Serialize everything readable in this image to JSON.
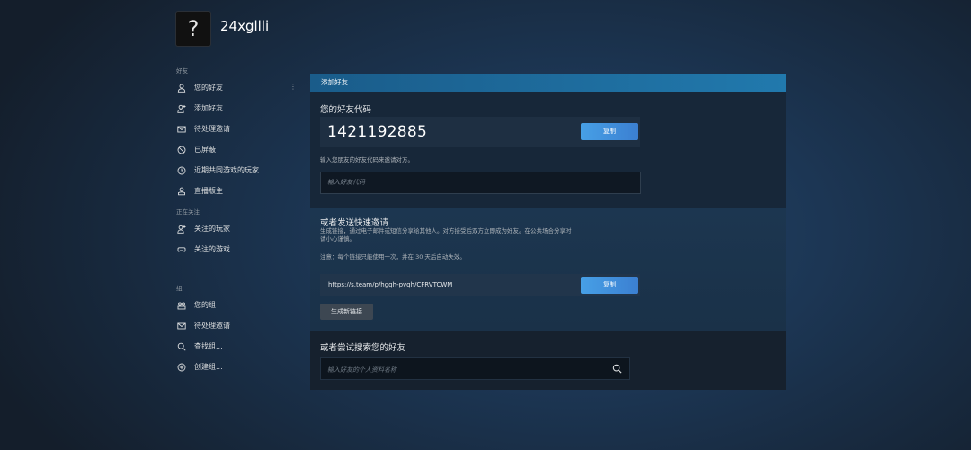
{
  "profile": {
    "username": "24xgllli",
    "avatar_glyph": "?"
  },
  "sidebar": {
    "section_friends": "好友",
    "friends_items": [
      {
        "label": "您的好友",
        "icon": "person-icon"
      },
      {
        "label": "添加好友",
        "icon": "person-add-icon"
      },
      {
        "label": "待处理邀请",
        "icon": "mail-icon"
      },
      {
        "label": "已屏蔽",
        "icon": "block-icon"
      },
      {
        "label": "近期共同游戏的玩家",
        "icon": "clock-icon"
      },
      {
        "label": "直播版主",
        "icon": "broadcast-mod-icon"
      }
    ],
    "friends_menu_dots": "⋮",
    "section_following": "正在关注",
    "following_items": [
      {
        "label": "关注的玩家",
        "icon": "person-follow-icon"
      },
      {
        "label": "关注的游戏...",
        "icon": "gamepad-icon"
      }
    ],
    "section_groups": "组",
    "group_items": [
      {
        "label": "您的组",
        "icon": "group-icon"
      },
      {
        "label": "待处理邀请",
        "icon": "mail-icon"
      },
      {
        "label": "查找组...",
        "icon": "search-icon"
      },
      {
        "label": "创建组...",
        "icon": "plus-circle-icon"
      }
    ]
  },
  "panel": {
    "header": "添加好友",
    "friend_code_title": "您的好友代码",
    "friend_code": "1421192885",
    "copy_label": "复制",
    "enter_code_hint": "输入您朋友的好友代码来邀请对方。",
    "enter_code_placeholder": "输入好友代码",
    "quick_invite_title": "或者发送快速邀请",
    "quick_invite_desc_1": "生成链接，通过电子邮件或短信分享给其他人。对方接受后双方立即成为好友。在公共场合分享时",
    "quick_invite_desc_2": "请小心谨慎。",
    "quick_invite_note": "注意：每个链接只能使用一次，并在 30 天后自动失效。",
    "invite_link": "https://s.team/p/hgqh-pvqh/CFRVTCWM",
    "copy_link_label": "复制",
    "generate_link_label": "生成新链接",
    "search_title": "或者尝试搜索您的好友",
    "search_placeholder": "输入好友的个人资料名称"
  },
  "colors": {
    "accent": "#1f6fa0",
    "button_blue": "#47a0e6",
    "background": "#1b2838"
  }
}
